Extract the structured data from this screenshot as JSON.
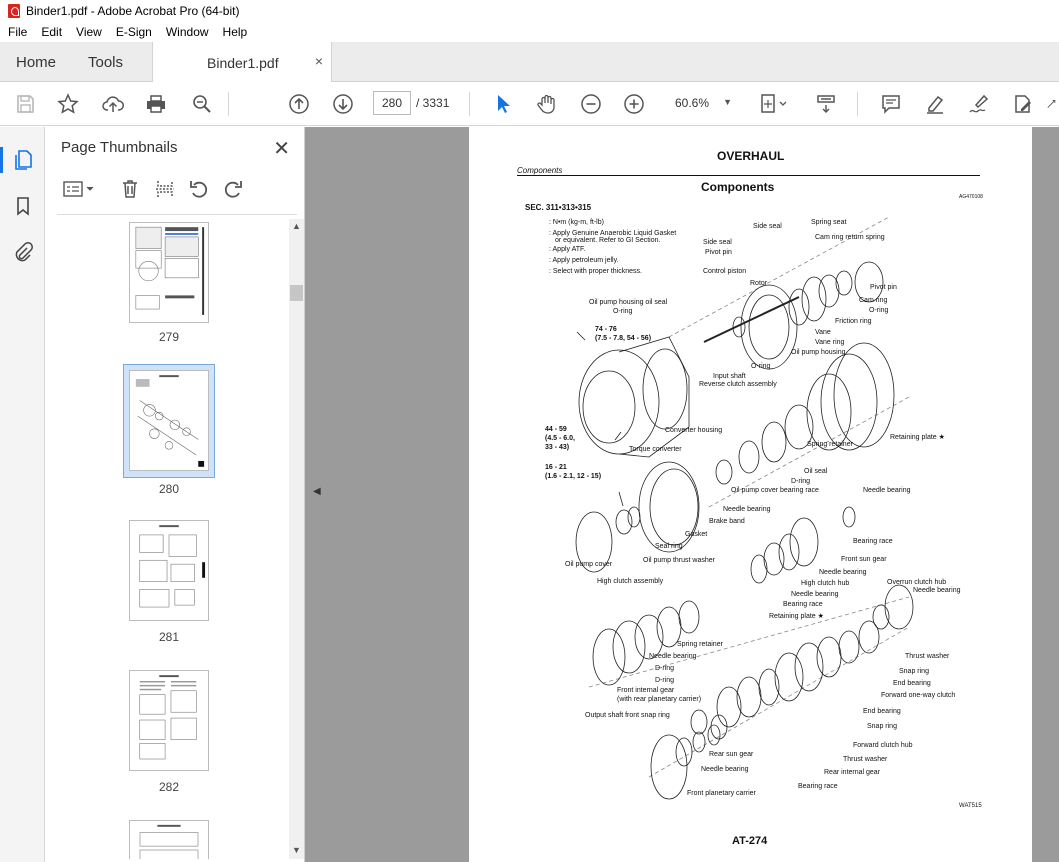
{
  "window": {
    "title": "Binder1.pdf - Adobe Acrobat Pro (64-bit)"
  },
  "menu": [
    "File",
    "Edit",
    "View",
    "E-Sign",
    "Window",
    "Help"
  ],
  "tabs": {
    "home": "Home",
    "tools": "Tools",
    "document": "Binder1.pdf",
    "close": "×"
  },
  "toolbar": {
    "current_page": "280",
    "page_total": "/  3331",
    "zoom": "60.6%"
  },
  "panel": {
    "title": "Page Thumbnails",
    "close": "✕",
    "thumbnails": [
      {
        "page": "279",
        "selected": false
      },
      {
        "page": "280",
        "selected": true
      },
      {
        "page": "281",
        "selected": false
      },
      {
        "page": "282",
        "selected": false
      }
    ]
  },
  "document": {
    "heading": "OVERHAUL",
    "section_tag": "Components",
    "section_title": "Components",
    "code_top_right": "AG470108",
    "sec_ref": "SEC. 311•313•315",
    "legend": [
      ": N•m (kg-m, ft-lb)",
      ": Apply Genuine Anaerobic Liquid Gasket",
      "or equivalent. Refer to GI Section.",
      ": Apply ATF.",
      ": Apply petroleum jelly.",
      ": Select with proper thickness."
    ],
    "torques": [
      "74 - 76",
      "(7.5 - 7.8, 54 - 56)",
      "44 - 59",
      "(4.5 - 6.0,",
      "33 - 43)",
      "16 - 21",
      "(1.6 - 2.1, 12 - 15)"
    ],
    "labels": [
      "Spring seat",
      "Side seal",
      "Cam ring return spring",
      "Side seal",
      "Pivot pin",
      "Control piston",
      "Pivot pin",
      "Rotor",
      "Cam ring",
      "O-ring",
      "Oil pump housing oil seal",
      "O-ring",
      "Friction ring",
      "Vane",
      "Vane ring",
      "Oil pump housing",
      "O-ring",
      "Input shaft",
      "Reverse clutch assembly",
      "Retaining plate ★",
      "Spring retainer",
      "Converter housing",
      "Torque converter",
      "Oil seal",
      "D-ring",
      "Oil pump cover bearing race",
      "Needle bearing",
      "Needle bearing",
      "Brake band",
      "Bearing race",
      "Gasket",
      "Front sun gear",
      "Seal ring",
      "Needle bearing",
      "Oil pump thrust washer",
      "Oil pump cover",
      "High clutch hub",
      "Overrun clutch hub",
      "High clutch assembly",
      "Needle bearing",
      "Needle bearing",
      "Bearing race",
      "Retaining plate ★",
      "Spring retainer",
      "Thrust washer",
      "Needle bearing",
      "Snap ring",
      "D-ring",
      "End bearing",
      "D-ring",
      "Forward one-way clutch",
      "Front internal gear",
      "(with rear planetary carrier)",
      "End bearing",
      "Output shaft front snap ring",
      "Snap ring",
      "Forward clutch hub",
      "Rear sun gear",
      "Thrust washer",
      "Needle bearing",
      "Rear internal gear",
      "Bearing race",
      "Front planetary carrier"
    ],
    "figure_code": "WAT515",
    "page_footer": "AT-274"
  },
  "colors": {
    "accent": "#1473e6",
    "doc_bg": "#9b9b9b",
    "pdf_red": "#d9261c"
  }
}
